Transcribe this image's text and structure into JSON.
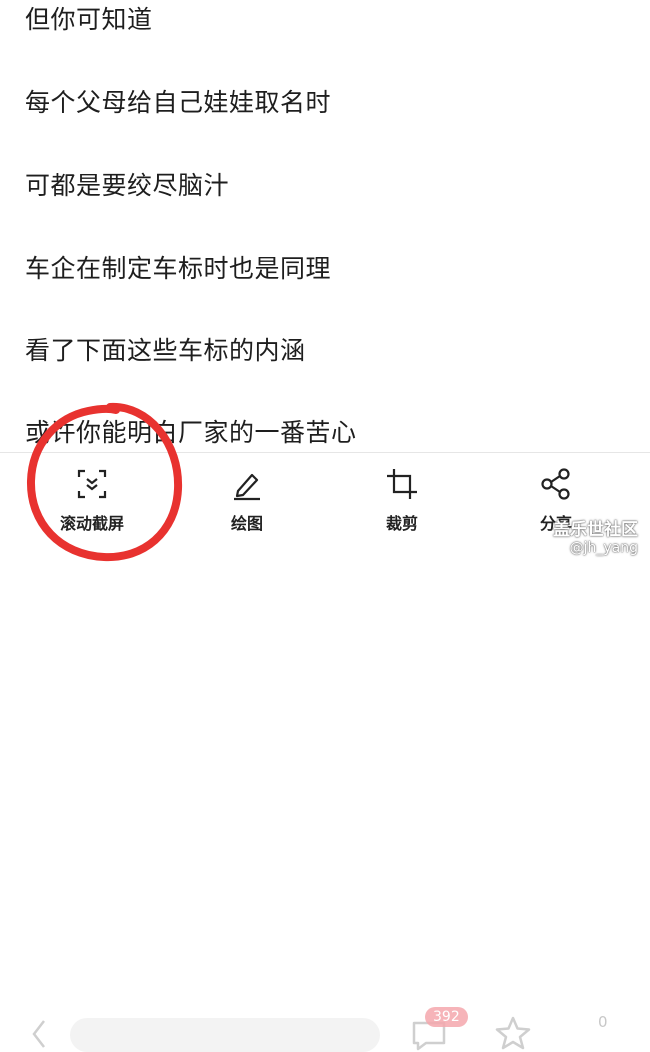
{
  "article": {
    "lines": [
      "但你可知道",
      "每个父母给自己娃娃取名时",
      "可都是要绞尽脑汁",
      "车企在制定车标时也是同理",
      "看了下面这些车标的内涵",
      "或许你能明白厂家的一番苦心"
    ]
  },
  "toolbar": {
    "scroll_capture_label": "滚动截屏",
    "draw_label": "绘图",
    "crop_label": "裁剪",
    "share_label": "分享"
  },
  "bottom_bar": {
    "comment_count": "392",
    "favorite_count": "0"
  },
  "watermark": {
    "title": "盖乐世社区",
    "user": "@jh_yang"
  },
  "colors": {
    "annotation_red": "#e8322f",
    "badge_pink": "#f5a8ad"
  }
}
